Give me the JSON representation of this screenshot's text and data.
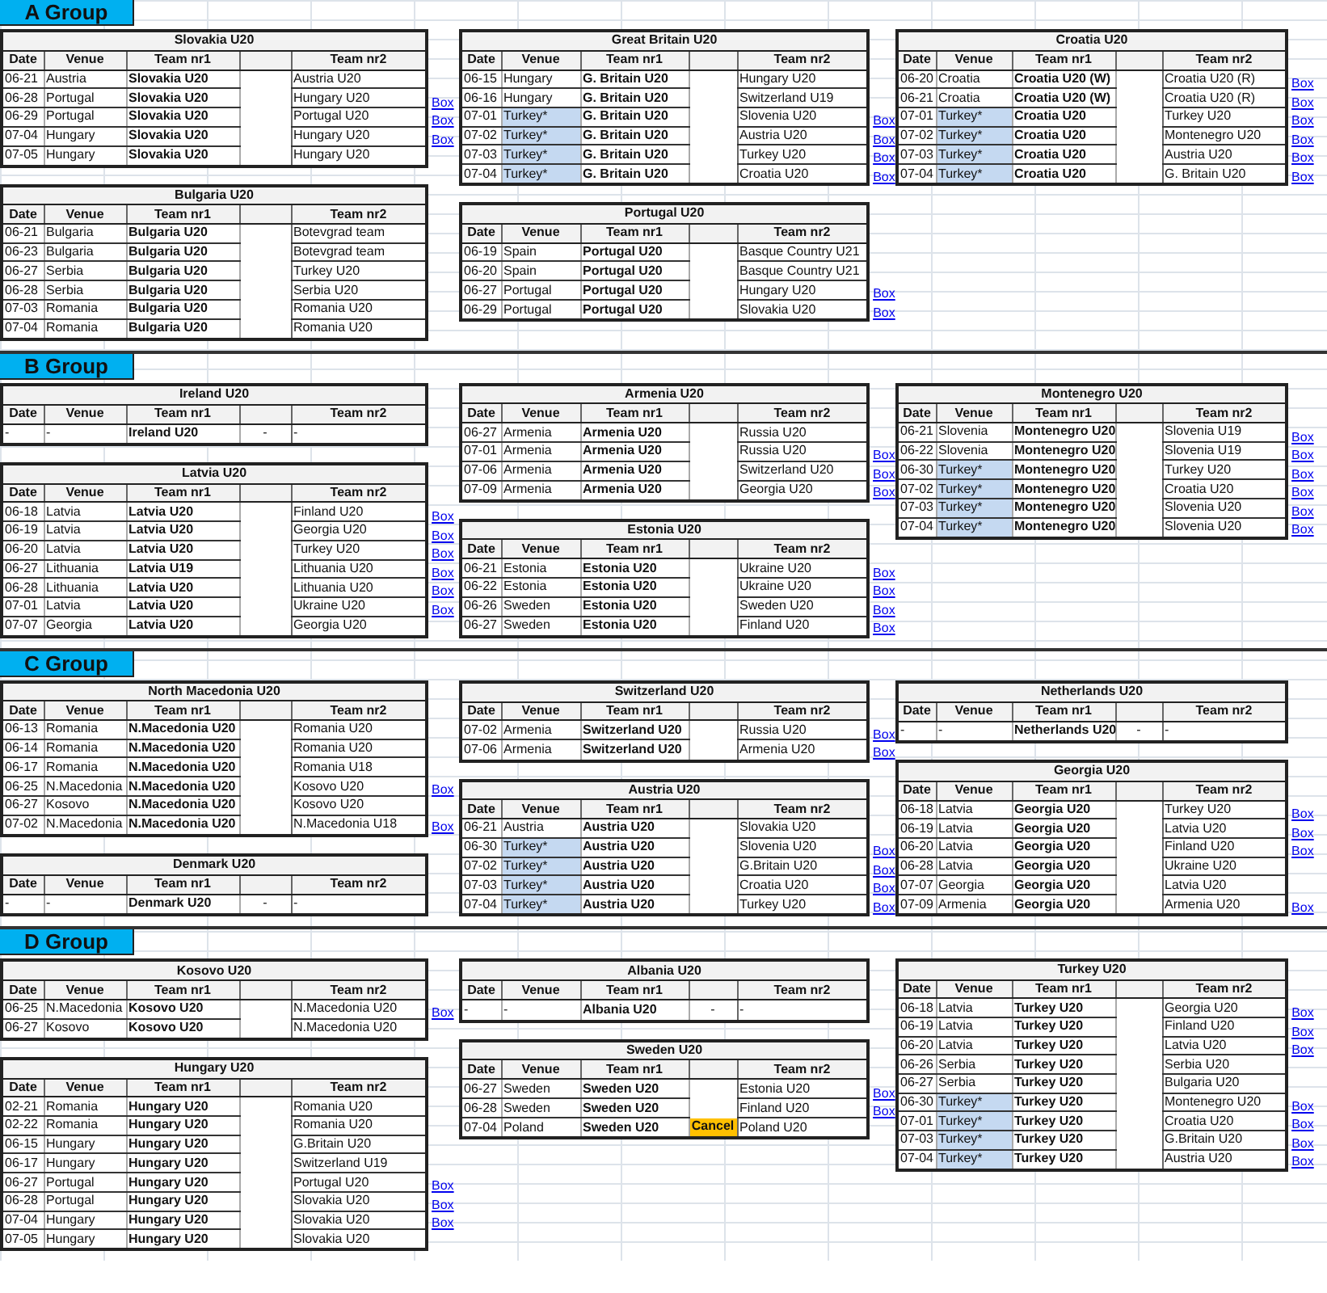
{
  "groups": [
    {
      "title": "A Group",
      "columns": [
        {
          "tables": [
            {
              "title": "Slovakia U20",
              "headers": [
                "Date",
                "Venue",
                "Team nr1",
                "Team nr2"
              ],
              "rows": [
                {
                  "date": "06-21",
                  "venue": "Austria",
                  "team1": "Slovakia U20",
                  "team2": "Austria U20"
                },
                {
                  "date": "06-28",
                  "venue": "Portugal",
                  "team1": "Slovakia U20",
                  "team2": "Hungary U20",
                  "link": "Box"
                },
                {
                  "date": "06-29",
                  "venue": "Portugal",
                  "team1": "Slovakia U20",
                  "team2": "Portugal U20",
                  "link": "Box"
                },
                {
                  "date": "07-04",
                  "venue": "Hungary",
                  "team1": "Slovakia U20",
                  "team2": "Hungary U20",
                  "link": "Box"
                },
                {
                  "date": "07-05",
                  "venue": "Hungary",
                  "team1": "Slovakia U20",
                  "team2": "Hungary U20"
                }
              ]
            },
            {
              "title": "Bulgaria U20",
              "headers": [
                "Date",
                "Venue",
                "Team nr1",
                "Team nr2"
              ],
              "rows": [
                {
                  "date": "06-21",
                  "venue": "Bulgaria",
                  "team1": "Bulgaria U20",
                  "team2": "Botevgrad team"
                },
                {
                  "date": "06-23",
                  "venue": "Bulgaria",
                  "team1": "Bulgaria U20",
                  "team2": "Botevgrad team"
                },
                {
                  "date": "06-27",
                  "venue": "Serbia",
                  "team1": "Bulgaria U20",
                  "team2": "Turkey U20"
                },
                {
                  "date": "06-28",
                  "venue": "Serbia",
                  "team1": "Bulgaria U20",
                  "team2": "Serbia U20"
                },
                {
                  "date": "07-03",
                  "venue": "Romania",
                  "team1": "Bulgaria U20",
                  "team2": "Romania U20"
                },
                {
                  "date": "07-04",
                  "venue": "Romania",
                  "team1": "Bulgaria U20",
                  "team2": "Romania U20"
                }
              ]
            }
          ]
        },
        {
          "tables": [
            {
              "title": "Great Britain U20",
              "headers": [
                "Date",
                "Venue",
                "Team nr1",
                "Team nr2"
              ],
              "rows": [
                {
                  "date": "06-15",
                  "venue": "Hungary",
                  "highlighted": false,
                  "team1": "G. Britain U20",
                  "team2": "Hungary U20"
                },
                {
                  "date": "06-16",
                  "venue": "Hungary",
                  "highlighted": false,
                  "team1": "G. Britain U20",
                  "team2": "Switzerland U19"
                },
                {
                  "date": "07-01",
                  "venue": "Turkey*",
                  "highlighted": true,
                  "team1": "G. Britain U20",
                  "team2": "Slovenia U20",
                  "link": "Box"
                },
                {
                  "date": "07-02",
                  "venue": "Turkey*",
                  "highlighted": true,
                  "team1": "G. Britain U20",
                  "team2": "Austria U20",
                  "link": "Box"
                },
                {
                  "date": "07-03",
                  "venue": "Turkey*",
                  "highlighted": true,
                  "team1": "G. Britain U20",
                  "team2": "Turkey U20",
                  "link": "Box"
                },
                {
                  "date": "07-04",
                  "venue": "Turkey*",
                  "highlighted": true,
                  "team1": "G. Britain U20",
                  "team2": "Croatia U20",
                  "link": "Box"
                }
              ]
            },
            {
              "title": "Portugal U20",
              "headers": [
                "Date",
                "Venue",
                "Team nr1",
                "Team nr2"
              ],
              "rows": [
                {
                  "date": "06-19",
                  "venue": "Spain",
                  "team1": "Portugal U20",
                  "team2": "Basque Country U21"
                },
                {
                  "date": "06-20",
                  "venue": "Spain",
                  "team1": "Portugal U20",
                  "team2": "Basque Country U21"
                },
                {
                  "date": "06-27",
                  "venue": "Portugal",
                  "team1": "Portugal U20",
                  "team2": "Hungary U20",
                  "link": "Box"
                },
                {
                  "date": "06-29",
                  "venue": "Portugal",
                  "team1": "Portugal U20",
                  "team2": "Slovakia U20",
                  "link": "Box"
                }
              ]
            }
          ]
        },
        {
          "tables": [
            {
              "title": "Croatia U20",
              "headers": [
                "Date",
                "Venue",
                "Team nr1",
                "Team nr2"
              ],
              "rows": [
                {
                  "date": "06-20",
                  "venue": "Croatia",
                  "highlighted": false,
                  "team1": "Croatia U20 (W)",
                  "team2": "Croatia U20 (R)",
                  "link": "Box"
                },
                {
                  "date": "06-21",
                  "venue": "Croatia",
                  "highlighted": false,
                  "team1": "Croatia U20 (W)",
                  "team2": "Croatia U20 (R)",
                  "link": "Box"
                },
                {
                  "date": "07-01",
                  "venue": "Turkey*",
                  "highlighted": true,
                  "team1": "Croatia U20",
                  "team2": "Turkey U20",
                  "link": "Box"
                },
                {
                  "date": "07-02",
                  "venue": "Turkey*",
                  "highlighted": true,
                  "team1": "Croatia U20",
                  "team2": "Montenegro U20",
                  "link": "Box"
                },
                {
                  "date": "07-03",
                  "venue": "Turkey*",
                  "highlighted": true,
                  "team1": "Croatia U20",
                  "team2": "Austria U20",
                  "link": "Box"
                },
                {
                  "date": "07-04",
                  "venue": "Turkey*",
                  "highlighted": true,
                  "team1": "Croatia U20",
                  "team2": "G. Britain U20",
                  "link": "Box"
                }
              ]
            }
          ]
        }
      ]
    },
    {
      "title": "B Group",
      "columns": [
        {
          "tables": [
            {
              "title": "Ireland U20",
              "headers": [
                "Date",
                "Venue",
                "Team nr1",
                "Team nr2"
              ],
              "rows": [
                {
                  "date": "-",
                  "venue": "-",
                  "team1": "Ireland U20",
                  "score": "-",
                  "team2": "-"
                }
              ]
            },
            {
              "title": "Latvia U20",
              "headers": [
                "Date",
                "Venue",
                "Team nr1",
                "Team nr2"
              ],
              "rows": [
                {
                  "date": "06-18",
                  "venue": "Latvia",
                  "team1": "Latvia U20",
                  "team2": "Finland U20",
                  "link": "Box"
                },
                {
                  "date": "06-19",
                  "venue": "Latvia",
                  "team1": "Latvia U20",
                  "team2": "Georgia U20",
                  "link": "Box"
                },
                {
                  "date": "06-20",
                  "venue": "Latvia",
                  "team1": "Latvia U20",
                  "team2": "Turkey U20",
                  "link": "Box"
                },
                {
                  "date": "06-27",
                  "venue": "Lithuania",
                  "team1": "Latvia U19",
                  "team2": "Lithuania U20",
                  "link": "Box"
                },
                {
                  "date": "06-28",
                  "venue": "Lithuania",
                  "team1": "Latvia U20",
                  "team2": "Lithuania U20",
                  "link": "Box"
                },
                {
                  "date": "07-01",
                  "venue": "Latvia",
                  "team1": "Latvia U20",
                  "team2": "Ukraine U20",
                  "link": "Box"
                },
                {
                  "date": "07-07",
                  "venue": "Georgia",
                  "team1": "Latvia U20",
                  "team2": "Georgia U20"
                }
              ]
            }
          ]
        },
        {
          "tables": [
            {
              "title": "Armenia U20",
              "headers": [
                "Date",
                "Venue",
                "Team nr1",
                "Team nr2"
              ],
              "rows": [
                {
                  "date": "06-27",
                  "venue": "Armenia",
                  "team1": "Armenia U20",
                  "team2": "Russia U20"
                },
                {
                  "date": "07-01",
                  "venue": "Armenia",
                  "team1": "Armenia U20",
                  "team2": "Russia U20",
                  "link": "Box"
                },
                {
                  "date": "07-06",
                  "venue": "Armenia",
                  "team1": "Armenia U20",
                  "team2": "Switzerland U20",
                  "link": "Box"
                },
                {
                  "date": "07-09",
                  "venue": "Armenia",
                  "team1": "Armenia U20",
                  "team2": "Georgia U20",
                  "link": "Box"
                }
              ]
            },
            {
              "title": "Estonia U20",
              "headers": [
                "Date",
                "Venue",
                "Team nr1",
                "Team nr2"
              ],
              "rows": [
                {
                  "date": "06-21",
                  "venue": "Estonia",
                  "team1": "Estonia U20",
                  "team2": "Ukraine U20",
                  "link": "Box"
                },
                {
                  "date": "06-22",
                  "venue": "Estonia",
                  "team1": "Estonia U20",
                  "team2": "Ukraine U20",
                  "link": "Box"
                },
                {
                  "date": "06-26",
                  "venue": "Sweden",
                  "team1": "Estonia U20",
                  "team2": "Sweden U20",
                  "link": "Box"
                },
                {
                  "date": "06-27",
                  "venue": "Sweden",
                  "team1": "Estonia U20",
                  "team2": "Finland U20",
                  "link": "Box"
                }
              ]
            }
          ]
        },
        {
          "tables": [
            {
              "title": "Montenegro U20",
              "headers": [
                "Date",
                "Venue",
                "Team nr1",
                "Team nr2"
              ],
              "rows": [
                {
                  "date": "06-21",
                  "venue": "Slovenia",
                  "highlighted": false,
                  "team1": "Montenegro U20",
                  "team2": "Slovenia U19",
                  "link": "Box"
                },
                {
                  "date": "06-22",
                  "venue": "Slovenia",
                  "highlighted": false,
                  "team1": "Montenegro U20",
                  "team2": "Slovenia U19",
                  "link": "Box"
                },
                {
                  "date": "06-30",
                  "venue": "Turkey*",
                  "highlighted": true,
                  "team1": "Montenegro U20",
                  "team2": "Turkey U20",
                  "link": "Box"
                },
                {
                  "date": "07-02",
                  "venue": "Turkey*",
                  "highlighted": true,
                  "team1": "Montenegro U20",
                  "team2": "Croatia U20",
                  "link": "Box"
                },
                {
                  "date": "07-03",
                  "venue": "Turkey*",
                  "highlighted": true,
                  "team1": "Montenegro U20",
                  "team2": "Slovenia U20",
                  "link": "Box"
                },
                {
                  "date": "07-04",
                  "venue": "Turkey*",
                  "highlighted": true,
                  "team1": "Montenegro U20",
                  "team2": "Slovenia U20",
                  "link": "Box"
                }
              ]
            }
          ]
        }
      ]
    },
    {
      "title": "C Group",
      "columns": [
        {
          "tables": [
            {
              "title": "North Macedonia U20",
              "headers": [
                "Date",
                "Venue",
                "Team nr1",
                "Team nr2"
              ],
              "rows": [
                {
                  "date": "06-13",
                  "venue": "Romania",
                  "team1": "N.Macedonia U20",
                  "team2": "Romania U20"
                },
                {
                  "date": "06-14",
                  "venue": "Romania",
                  "team1": "N.Macedonia U20",
                  "team2": "Romania U20"
                },
                {
                  "date": "06-17",
                  "venue": "Romania",
                  "team1": "N.Macedonia U20",
                  "team2": "Romania U18"
                },
                {
                  "date": "06-25",
                  "venue": "N.Macedonia",
                  "team1": "N.Macedonia U20",
                  "team2": "Kosovo U20",
                  "link": "Box"
                },
                {
                  "date": "06-27",
                  "venue": "Kosovo",
                  "team1": "N.Macedonia U20",
                  "team2": "Kosovo U20"
                },
                {
                  "date": "07-02",
                  "venue": "N.Macedonia",
                  "team1": "N.Macedonia U20",
                  "team2": "N.Macedonia U18",
                  "link": "Box"
                }
              ]
            },
            {
              "title": "Denmark U20",
              "headers": [
                "Date",
                "Venue",
                "Team nr1",
                "Team nr2"
              ],
              "rows": [
                {
                  "date": "-",
                  "venue": "-",
                  "team1": "Denmark U20",
                  "score": "-",
                  "team2": "-"
                }
              ]
            }
          ]
        },
        {
          "tables": [
            {
              "title": "Switzerland U20",
              "headers": [
                "Date",
                "Venue",
                "Team nr1",
                "Team nr2"
              ],
              "rows": [
                {
                  "date": "07-02",
                  "venue": "Armenia",
                  "team1": "Switzerland U20",
                  "team2": "Russia U20",
                  "link": "Box"
                },
                {
                  "date": "07-06",
                  "venue": "Armenia",
                  "team1": "Switzerland U20",
                  "team2": "Armenia U20",
                  "link": "Box"
                }
              ]
            },
            {
              "title": "Austria U20",
              "headers": [
                "Date",
                "Venue",
                "Team nr1",
                "Team nr2"
              ],
              "rows": [
                {
                  "date": "06-21",
                  "venue": "Austria",
                  "highlighted": false,
                  "team1": "Austria U20",
                  "team2": "Slovakia U20"
                },
                {
                  "date": "06-30",
                  "venue": "Turkey*",
                  "highlighted": true,
                  "team1": "Austria U20",
                  "team2": "Slovenia U20",
                  "link": "Box"
                },
                {
                  "date": "07-02",
                  "venue": "Turkey*",
                  "highlighted": true,
                  "team1": "Austria U20",
                  "team2": "G.Britain U20",
                  "link": "Box"
                },
                {
                  "date": "07-03",
                  "venue": "Turkey*",
                  "highlighted": true,
                  "team1": "Austria U20",
                  "team2": "Croatia U20",
                  "link": "Box"
                },
                {
                  "date": "07-04",
                  "venue": "Turkey*",
                  "highlighted": true,
                  "team1": "Austria U20",
                  "team2": "Turkey U20",
                  "link": "Box"
                }
              ]
            }
          ]
        },
        {
          "tables": [
            {
              "title": "Netherlands U20",
              "headers": [
                "Date",
                "Venue",
                "Team nr1",
                "Team nr2"
              ],
              "rows": [
                {
                  "date": "-",
                  "venue": "-",
                  "team1": "Netherlands U20",
                  "score": "-",
                  "team2": "-"
                }
              ]
            },
            {
              "title": "Georgia U20",
              "headers": [
                "Date",
                "Venue",
                "Team nr1",
                "Team nr2"
              ],
              "rows": [
                {
                  "date": "06-18",
                  "venue": "Latvia",
                  "team1": "Georgia U20",
                  "team2": "Turkey U20",
                  "link": "Box"
                },
                {
                  "date": "06-19",
                  "venue": "Latvia",
                  "team1": "Georgia U20",
                  "team2": "Latvia U20",
                  "link": "Box"
                },
                {
                  "date": "06-20",
                  "venue": "Latvia",
                  "team1": "Georgia U20",
                  "team2": "Finland U20",
                  "link": "Box"
                },
                {
                  "date": "06-28",
                  "venue": "Latvia",
                  "team1": "Georgia U20",
                  "team2": "Ukraine U20"
                },
                {
                  "date": "07-07",
                  "venue": "Georgia",
                  "team1": "Georgia U20",
                  "team2": "Latvia U20"
                },
                {
                  "date": "07-09",
                  "venue": "Armenia",
                  "team1": "Georgia U20",
                  "team2": "Armenia U20",
                  "link": "Box"
                }
              ]
            }
          ]
        }
      ]
    },
    {
      "title": "D Group",
      "columns": [
        {
          "tables": [
            {
              "title": "Kosovo U20",
              "headers": [
                "Date",
                "Venue",
                "Team nr1",
                "Team nr2"
              ],
              "rows": [
                {
                  "date": "06-25",
                  "venue": "N.Macedonia",
                  "team1": "Kosovo U20",
                  "team2": "N.Macedonia U20",
                  "link": "Box"
                },
                {
                  "date": "06-27",
                  "venue": "Kosovo",
                  "team1": "Kosovo U20",
                  "team2": "N.Macedonia U20"
                }
              ]
            },
            {
              "title": "Hungary U20",
              "headers": [
                "Date",
                "Venue",
                "Team nr1",
                "Team nr2"
              ],
              "rows": [
                {
                  "date": "02-21",
                  "venue": "Romania",
                  "team1": "Hungary U20",
                  "team2": "Romania U20"
                },
                {
                  "date": "02-22",
                  "venue": "Romania",
                  "team1": "Hungary U20",
                  "team2": "Romania U20"
                },
                {
                  "date": "06-15",
                  "venue": "Hungary",
                  "team1": "Hungary U20",
                  "team2": "G.Britain U20"
                },
                {
                  "date": "06-17",
                  "venue": "Hungary",
                  "team1": "Hungary U20",
                  "team2": "Switzerland U19"
                },
                {
                  "date": "06-27",
                  "venue": "Portugal",
                  "team1": "Hungary U20",
                  "team2": "Portugal U20",
                  "link": "Box"
                },
                {
                  "date": "06-28",
                  "venue": "Portugal",
                  "team1": "Hungary U20",
                  "team2": "Slovakia U20",
                  "link": "Box"
                },
                {
                  "date": "07-04",
                  "venue": "Hungary",
                  "team1": "Hungary U20",
                  "team2": "Slovakia U20",
                  "link": "Box"
                },
                {
                  "date": "07-05",
                  "venue": "Hungary",
                  "team1": "Hungary U20",
                  "team2": "Slovakia U20"
                }
              ]
            }
          ]
        },
        {
          "tables": [
            {
              "title": "Albania U20",
              "headers": [
                "Date",
                "Venue",
                "Team nr1",
                "Team nr2"
              ],
              "rows": [
                {
                  "date": "-",
                  "venue": "-",
                  "team1": "Albania U20",
                  "score": "-",
                  "team2": "-"
                }
              ]
            },
            {
              "title": "Sweden U20",
              "headers": [
                "Date",
                "Venue",
                "Team nr1",
                "Team nr2"
              ],
              "rows": [
                {
                  "date": "06-27",
                  "venue": "Sweden",
                  "team1": "Sweden U20",
                  "cancelled": false,
                  "team2": "Estonia U20",
                  "link": "Box"
                },
                {
                  "date": "06-28",
                  "venue": "Sweden",
                  "team1": "Sweden U20",
                  "cancelled": false,
                  "team2": "Finland U20",
                  "link": "Box"
                },
                {
                  "date": "07-04",
                  "venue": "Poland",
                  "team1": "Sweden U20",
                  "score": "Cancel",
                  "cancelled": true,
                  "team2": "Poland U20"
                }
              ]
            }
          ]
        },
        {
          "tables": [
            {
              "title": "Turkey U20",
              "headers": [
                "Date",
                "Venue",
                "Team nr1",
                "Team nr2"
              ],
              "rows": [
                {
                  "date": "06-18",
                  "venue": "Latvia",
                  "highlighted": false,
                  "team1": "Turkey U20",
                  "team2": "Georgia U20",
                  "link": "Box"
                },
                {
                  "date": "06-19",
                  "venue": "Latvia",
                  "highlighted": false,
                  "team1": "Turkey U20",
                  "team2": "Finland U20",
                  "link": "Box"
                },
                {
                  "date": "06-20",
                  "venue": "Latvia",
                  "highlighted": false,
                  "team1": "Turkey U20",
                  "team2": "Latvia U20",
                  "link": "Box"
                },
                {
                  "date": "06-26",
                  "venue": "Serbia",
                  "highlighted": false,
                  "team1": "Turkey U20",
                  "team2": "Serbia U20"
                },
                {
                  "date": "06-27",
                  "venue": "Serbia",
                  "highlighted": false,
                  "team1": "Turkey U20",
                  "team2": "Bulgaria U20"
                },
                {
                  "date": "06-30",
                  "venue": "Turkey*",
                  "highlighted": true,
                  "team1": "Turkey U20",
                  "team2": "Montenegro U20",
                  "link": "Box"
                },
                {
                  "date": "07-01",
                  "venue": "Turkey*",
                  "highlighted": true,
                  "team1": "Turkey U20",
                  "team2": "Croatia U20",
                  "link": "Box"
                },
                {
                  "date": "07-03",
                  "venue": "Turkey*",
                  "highlighted": true,
                  "team1": "Turkey U20",
                  "team2": "G.Britain U20",
                  "link": "Box"
                },
                {
                  "date": "07-04",
                  "venue": "Turkey*",
                  "highlighted": true,
                  "team1": "Turkey U20",
                  "team2": "Austria U20",
                  "link": "Box"
                }
              ]
            }
          ]
        }
      ]
    }
  ]
}
